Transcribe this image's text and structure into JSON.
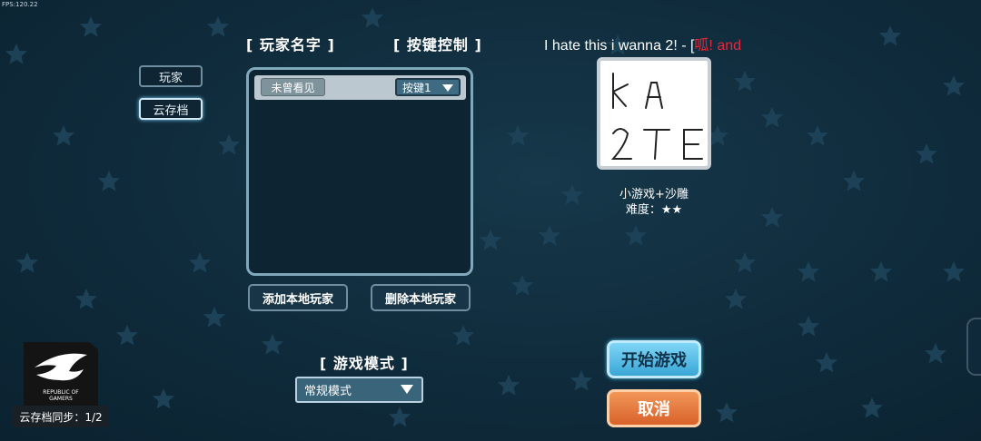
{
  "fps": "FPS:120.22",
  "sidebar": {
    "items": [
      {
        "label": "玩家"
      },
      {
        "label": "云存档"
      }
    ]
  },
  "sections": {
    "player_name": "[ 玩家名字 ]",
    "key_control": "[ 按键控制 ]",
    "game_mode": "[ 游戏模式 ]"
  },
  "players": [
    {
      "name": "未曾看见",
      "key": "按键1"
    }
  ],
  "buttons": {
    "add_local": "添加本地玩家",
    "remove_local": "删除本地玩家",
    "start": "开始游戏",
    "cancel": "取消"
  },
  "game_mode": {
    "selected": "常规模式"
  },
  "level": {
    "title_main": "I hate this i wanna 2! - [",
    "title_red": "呱! and",
    "thumbnail_text": [
      "ka",
      "2TE"
    ],
    "category": "小游戏+沙雕",
    "difficulty": "难度：★★"
  },
  "logo": {
    "lines": [
      "REPUBLIC OF",
      "GAMERS"
    ]
  },
  "sync_status": "云存档同步：1/2",
  "colors": {
    "background": "#0f2b3b",
    "accent_red": "#e5283a",
    "start_blue": "#3aa6d6",
    "cancel_orange": "#d8622a"
  }
}
